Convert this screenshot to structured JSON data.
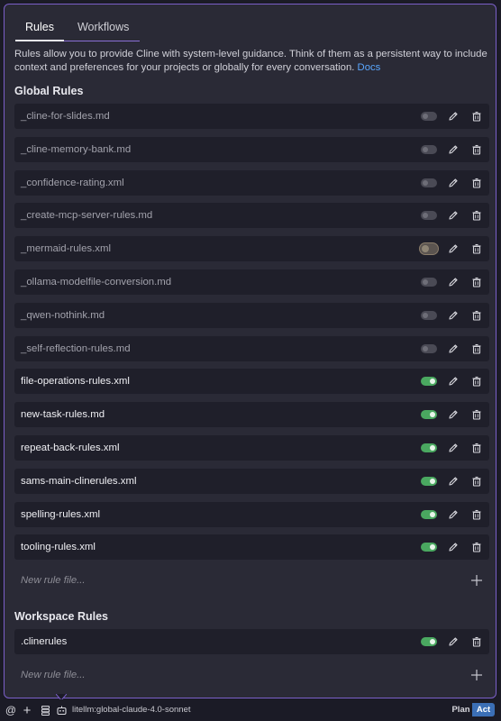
{
  "tabs": [
    {
      "label": "Rules",
      "active": true
    },
    {
      "label": "Workflows",
      "active": false
    }
  ],
  "description": {
    "text": "Rules allow you to provide Cline with system-level guidance. Think of them as a persistent way to include context and preferences for your projects or globally for every conversation.",
    "link_label": "Docs"
  },
  "global_rules": {
    "title": "Global Rules",
    "items": [
      {
        "name": "_cline-for-slides.md",
        "enabled": false
      },
      {
        "name": "_cline-memory-bank.md",
        "enabled": false
      },
      {
        "name": "_confidence-rating.xml",
        "enabled": false
      },
      {
        "name": "_create-mcp-server-rules.md",
        "enabled": false
      },
      {
        "name": "_mermaid-rules.xml",
        "enabled": false
      },
      {
        "name": "_ollama-modelfile-conversion.md",
        "enabled": false
      },
      {
        "name": "_qwen-nothink.md",
        "enabled": false
      },
      {
        "name": "_self-reflection-rules.md",
        "enabled": false
      },
      {
        "name": "file-operations-rules.xml",
        "enabled": true
      },
      {
        "name": "new-task-rules.md",
        "enabled": true
      },
      {
        "name": "repeat-back-rules.xml",
        "enabled": true
      },
      {
        "name": "sams-main-clinerules.xml",
        "enabled": true
      },
      {
        "name": "spelling-rules.xml",
        "enabled": true
      },
      {
        "name": "tooling-rules.xml",
        "enabled": true
      }
    ],
    "new_rule_placeholder": "New rule file..."
  },
  "workspace_rules": {
    "title": "Workspace Rules",
    "items": [
      {
        "name": ".clinerules",
        "enabled": true
      }
    ],
    "new_rule_placeholder": "New rule file..."
  },
  "bottom_bar": {
    "at_symbol": "@",
    "plus_symbol": "+",
    "model_name": "litellm:global-claude-4.0-sonnet",
    "mode_plan": "Plan",
    "mode_act": "Act",
    "active_mode": "Act"
  },
  "colors": {
    "accent_border": "#7a5fc8",
    "toggle_on": "#4aa860",
    "link": "#5aa7ff",
    "act_button": "#3b6fb6"
  }
}
